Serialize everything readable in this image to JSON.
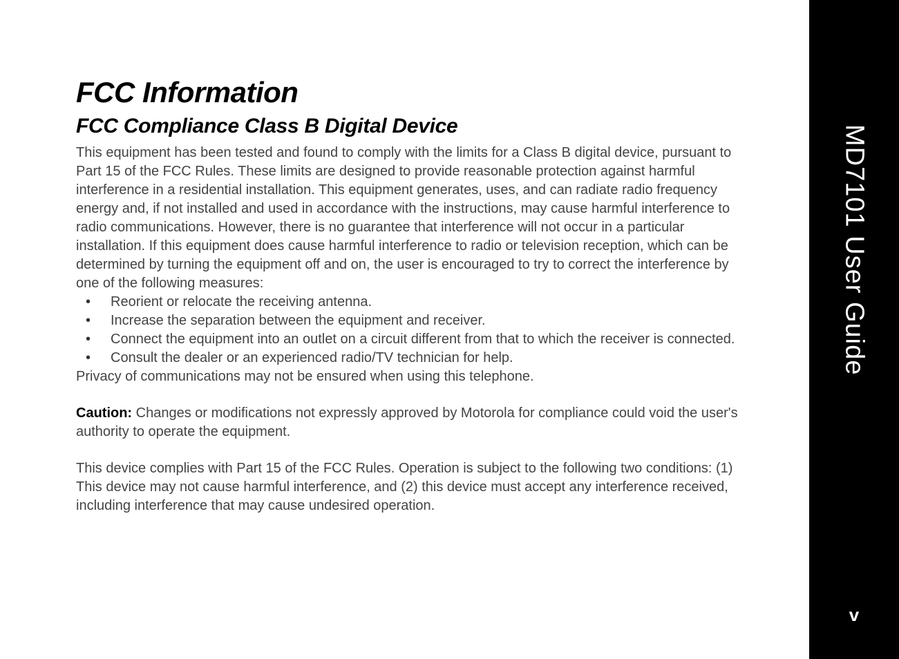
{
  "header": {
    "title": "FCC Information",
    "subtitle": "FCC Compliance Class B Digital Device"
  },
  "body": {
    "intro": "This equipment has been tested and found to comply with the limits for a Class B digital device, pursuant to Part 15 of the FCC Rules. These limits are designed to provide reasonable protection against harmful interference in a residential installation. This equipment generates, uses, and can radiate radio frequency energy and, if not installed and used in accordance with the instructions, may cause harmful interference to radio communications. However, there is no guarantee that interference will not occur in a particular installation. If this equipment does cause harmful interference to radio or television reception, which can be determined by turning the equipment off and on, the user is encouraged to try to correct the interference by one of the following measures:",
    "bullets": [
      "Reorient or relocate the receiving antenna.",
      "Increase the separation between the equipment and receiver.",
      "Connect the equipment into an outlet on a circuit different from that to which the receiver is connected.",
      "Consult the dealer or an experienced radio/TV technician for help."
    ],
    "privacy": "Privacy of communications may not be ensured when using this telephone.",
    "caution_label": "Caution:",
    "caution_text": " Changes or modifications not expressly approved by Motorola for compliance could void the user's authority to operate the equipment.",
    "part15": "This device complies with Part 15 of the FCC Rules. Operation is subject to the following two conditions: (1) This device may not cause harmful interference, and (2) this device must accept any interference received, including interference that may cause undesired operation."
  },
  "sidebar": {
    "doc_title": "MD7101 User Guide",
    "page_number": "v"
  }
}
